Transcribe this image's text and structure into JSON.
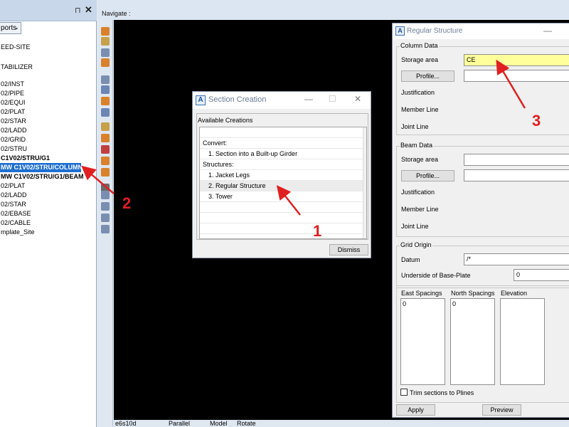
{
  "explorer": {
    "pin_glyph": "⊓",
    "close_glyph": "✕",
    "dropdown_label": "ports",
    "tree_items": [
      {
        "label": "EED-SITE",
        "style": "normal"
      },
      {
        "label": "TABILIZER",
        "style": "normal"
      },
      {
        "label": "02/INST",
        "style": "normal"
      },
      {
        "label": "02/PIPE",
        "style": "normal"
      },
      {
        "label": "02/EQUI",
        "style": "normal"
      },
      {
        "label": "02/PLAT",
        "style": "normal"
      },
      {
        "label": "02/STAR",
        "style": "normal"
      },
      {
        "label": "02/LADD",
        "style": "normal"
      },
      {
        "label": "02/GRID",
        "style": "normal"
      },
      {
        "label": "02/STRU",
        "style": "normal"
      },
      {
        "label": "C1V02/STRU/G1",
        "style": "bold"
      },
      {
        "label": "MW C1V02/STRU/COLUMN",
        "style": "selected"
      },
      {
        "label": "MW C1V02/STRU/G1/BEAM",
        "style": "bold"
      },
      {
        "label": "02/PLAT",
        "style": "normal"
      },
      {
        "label": "02/LADD",
        "style": "normal"
      },
      {
        "label": "02/STAR",
        "style": "normal"
      },
      {
        "label": "02/EBASE",
        "style": "normal"
      },
      {
        "label": "02/CABLE",
        "style": "normal"
      },
      {
        "label": "mplate_Site",
        "style": "normal"
      }
    ]
  },
  "navigate_label": "Navigate :",
  "statusbar": {
    "view": "e6s10d",
    "projection": "Parallel",
    "mode": "Model",
    "action": "Rotate"
  },
  "section_creation": {
    "title": "Section Creation",
    "frame_label": "Available Creations",
    "rows": [
      {
        "text": "",
        "indent": 0
      },
      {
        "text": "Convert:",
        "indent": 0
      },
      {
        "text": "1.  Section into a Built-up Girder",
        "indent": 1
      },
      {
        "text": "Structures:",
        "indent": 0
      },
      {
        "text": "1.  Jacket Legs",
        "indent": 1
      },
      {
        "text": "2.  Regular Structure",
        "indent": 1
      },
      {
        "text": "3.  Tower",
        "indent": 1
      },
      {
        "text": "",
        "indent": 0
      },
      {
        "text": "",
        "indent": 0
      },
      {
        "text": "",
        "indent": 0
      }
    ],
    "dismiss_label": "Dismiss"
  },
  "regular_structure": {
    "title": "Regular Structure",
    "column_data": {
      "group_label": "Column Data",
      "storage_label": "Storage area",
      "storage_value": "CE",
      "profile_label": "Profile...",
      "profile_value": "",
      "justification_label": "Justification",
      "member_line_label": "Member Line",
      "joint_line_label": "Joint Line"
    },
    "beam_data": {
      "group_label": "Beam Data",
      "storage_label": "Storage area",
      "storage_value": "",
      "profile_label": "Profile...",
      "profile_value": "",
      "justification_label": "Justification",
      "member_line_label": "Member Line",
      "joint_line_label": "Joint Line"
    },
    "grid_origin": {
      "group_label": "Grid Origin",
      "datum_label": "Datum",
      "datum_value": "/*",
      "underside_label": "Underside of Base-Plate",
      "underside_value": "0"
    },
    "spacings": {
      "east_label": "East Spacings",
      "east_value": "0",
      "north_label": "North Spacings",
      "north_value": "0",
      "elevation_label": "Elevation",
      "elevation_value": ""
    },
    "trim_label": "Trim sections to Plines",
    "apply_label": "Apply",
    "preview_label": "Preview"
  },
  "annotations": {
    "num1": "1",
    "num2": "2",
    "num3": "3",
    "color": "#e02020"
  },
  "colors": {
    "selection": "#1f6fd1",
    "highlight_field": "#ffff9c",
    "viewport": "#000000"
  }
}
